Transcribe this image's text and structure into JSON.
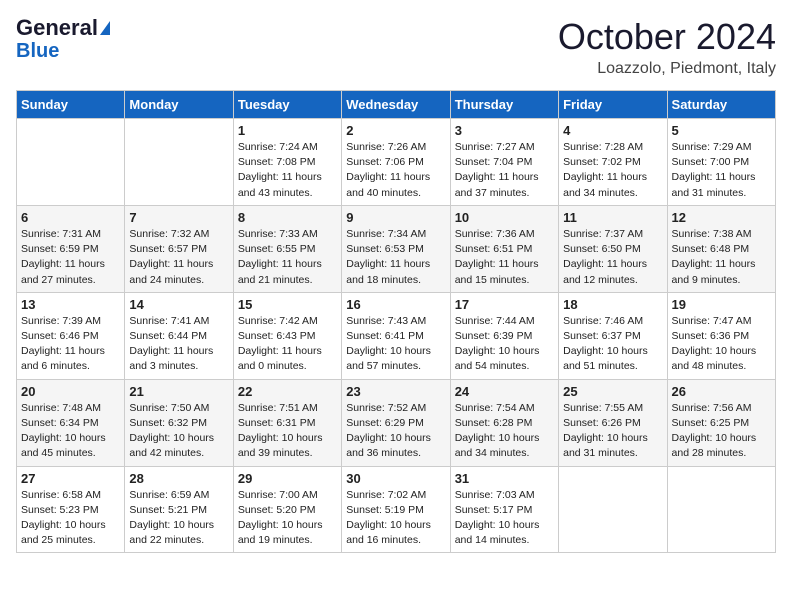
{
  "header": {
    "logo_line1": "General",
    "logo_line2": "Blue",
    "title": "October 2024",
    "location": "Loazzolo, Piedmont, Italy"
  },
  "days_of_week": [
    "Sunday",
    "Monday",
    "Tuesday",
    "Wednesday",
    "Thursday",
    "Friday",
    "Saturday"
  ],
  "weeks": [
    [
      {
        "num": "",
        "info": ""
      },
      {
        "num": "",
        "info": ""
      },
      {
        "num": "1",
        "info": "Sunrise: 7:24 AM\nSunset: 7:08 PM\nDaylight: 11 hours and 43 minutes."
      },
      {
        "num": "2",
        "info": "Sunrise: 7:26 AM\nSunset: 7:06 PM\nDaylight: 11 hours and 40 minutes."
      },
      {
        "num": "3",
        "info": "Sunrise: 7:27 AM\nSunset: 7:04 PM\nDaylight: 11 hours and 37 minutes."
      },
      {
        "num": "4",
        "info": "Sunrise: 7:28 AM\nSunset: 7:02 PM\nDaylight: 11 hours and 34 minutes."
      },
      {
        "num": "5",
        "info": "Sunrise: 7:29 AM\nSunset: 7:00 PM\nDaylight: 11 hours and 31 minutes."
      }
    ],
    [
      {
        "num": "6",
        "info": "Sunrise: 7:31 AM\nSunset: 6:59 PM\nDaylight: 11 hours and 27 minutes."
      },
      {
        "num": "7",
        "info": "Sunrise: 7:32 AM\nSunset: 6:57 PM\nDaylight: 11 hours and 24 minutes."
      },
      {
        "num": "8",
        "info": "Sunrise: 7:33 AM\nSunset: 6:55 PM\nDaylight: 11 hours and 21 minutes."
      },
      {
        "num": "9",
        "info": "Sunrise: 7:34 AM\nSunset: 6:53 PM\nDaylight: 11 hours and 18 minutes."
      },
      {
        "num": "10",
        "info": "Sunrise: 7:36 AM\nSunset: 6:51 PM\nDaylight: 11 hours and 15 minutes."
      },
      {
        "num": "11",
        "info": "Sunrise: 7:37 AM\nSunset: 6:50 PM\nDaylight: 11 hours and 12 minutes."
      },
      {
        "num": "12",
        "info": "Sunrise: 7:38 AM\nSunset: 6:48 PM\nDaylight: 11 hours and 9 minutes."
      }
    ],
    [
      {
        "num": "13",
        "info": "Sunrise: 7:39 AM\nSunset: 6:46 PM\nDaylight: 11 hours and 6 minutes."
      },
      {
        "num": "14",
        "info": "Sunrise: 7:41 AM\nSunset: 6:44 PM\nDaylight: 11 hours and 3 minutes."
      },
      {
        "num": "15",
        "info": "Sunrise: 7:42 AM\nSunset: 6:43 PM\nDaylight: 11 hours and 0 minutes."
      },
      {
        "num": "16",
        "info": "Sunrise: 7:43 AM\nSunset: 6:41 PM\nDaylight: 10 hours and 57 minutes."
      },
      {
        "num": "17",
        "info": "Sunrise: 7:44 AM\nSunset: 6:39 PM\nDaylight: 10 hours and 54 minutes."
      },
      {
        "num": "18",
        "info": "Sunrise: 7:46 AM\nSunset: 6:37 PM\nDaylight: 10 hours and 51 minutes."
      },
      {
        "num": "19",
        "info": "Sunrise: 7:47 AM\nSunset: 6:36 PM\nDaylight: 10 hours and 48 minutes."
      }
    ],
    [
      {
        "num": "20",
        "info": "Sunrise: 7:48 AM\nSunset: 6:34 PM\nDaylight: 10 hours and 45 minutes."
      },
      {
        "num": "21",
        "info": "Sunrise: 7:50 AM\nSunset: 6:32 PM\nDaylight: 10 hours and 42 minutes."
      },
      {
        "num": "22",
        "info": "Sunrise: 7:51 AM\nSunset: 6:31 PM\nDaylight: 10 hours and 39 minutes."
      },
      {
        "num": "23",
        "info": "Sunrise: 7:52 AM\nSunset: 6:29 PM\nDaylight: 10 hours and 36 minutes."
      },
      {
        "num": "24",
        "info": "Sunrise: 7:54 AM\nSunset: 6:28 PM\nDaylight: 10 hours and 34 minutes."
      },
      {
        "num": "25",
        "info": "Sunrise: 7:55 AM\nSunset: 6:26 PM\nDaylight: 10 hours and 31 minutes."
      },
      {
        "num": "26",
        "info": "Sunrise: 7:56 AM\nSunset: 6:25 PM\nDaylight: 10 hours and 28 minutes."
      }
    ],
    [
      {
        "num": "27",
        "info": "Sunrise: 6:58 AM\nSunset: 5:23 PM\nDaylight: 10 hours and 25 minutes."
      },
      {
        "num": "28",
        "info": "Sunrise: 6:59 AM\nSunset: 5:21 PM\nDaylight: 10 hours and 22 minutes."
      },
      {
        "num": "29",
        "info": "Sunrise: 7:00 AM\nSunset: 5:20 PM\nDaylight: 10 hours and 19 minutes."
      },
      {
        "num": "30",
        "info": "Sunrise: 7:02 AM\nSunset: 5:19 PM\nDaylight: 10 hours and 16 minutes."
      },
      {
        "num": "31",
        "info": "Sunrise: 7:03 AM\nSunset: 5:17 PM\nDaylight: 10 hours and 14 minutes."
      },
      {
        "num": "",
        "info": ""
      },
      {
        "num": "",
        "info": ""
      }
    ]
  ]
}
